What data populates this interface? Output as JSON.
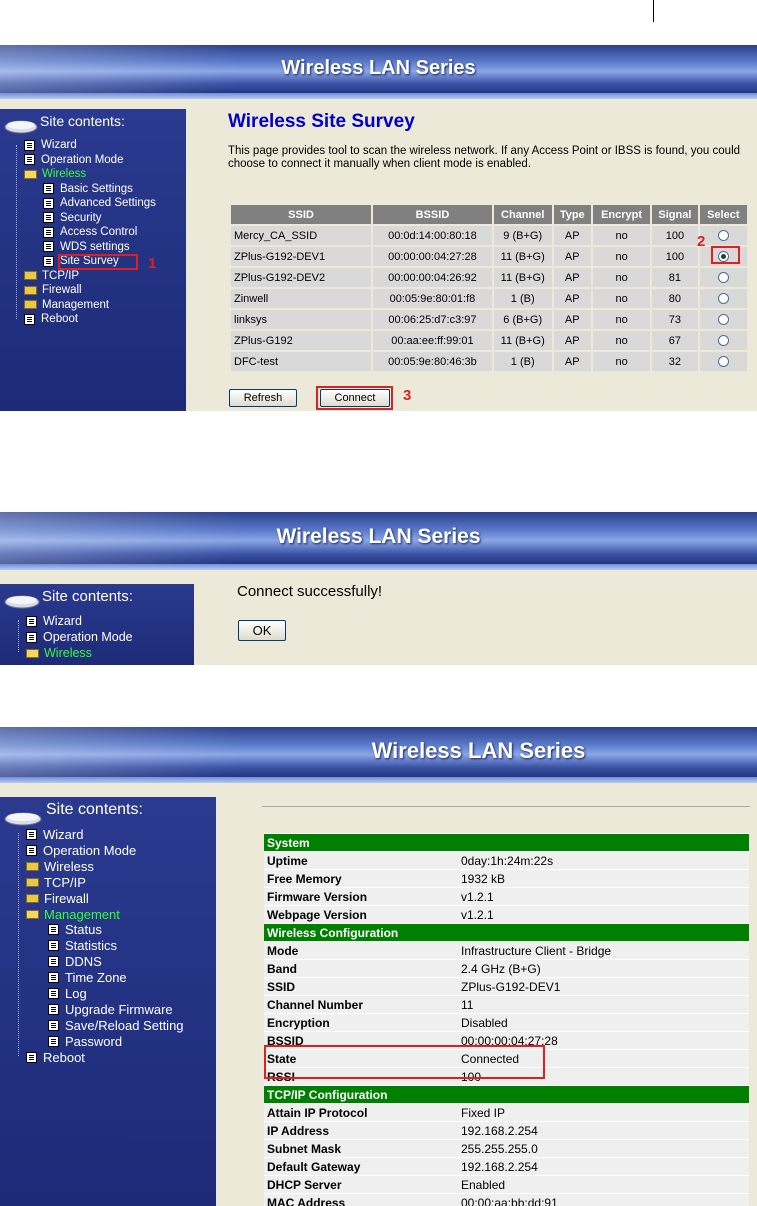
{
  "banner_title": "Wireless LAN Series",
  "sidebar_heading": "Site contents:",
  "survey": {
    "title": "Wireless Site Survey",
    "description": "This page provides tool to scan the wireless network. If any Access Point or IBSS is found, you could choose to connect it manually when client mode is enabled.",
    "columns": [
      "SSID",
      "BSSID",
      "Channel",
      "Type",
      "Encrypt",
      "Signal",
      "Select"
    ],
    "rows": [
      [
        "Mercy_CA_SSID",
        "00:0d:14:00:80:18",
        "9 (B+G)",
        "AP",
        "no",
        "100"
      ],
      [
        "ZPlus-G192-DEV1",
        "00:00:00:04:27:28",
        "11 (B+G)",
        "AP",
        "no",
        "100"
      ],
      [
        "ZPlus-G192-DEV2",
        "00:00:00:04:26:92",
        "11 (B+G)",
        "AP",
        "no",
        "81"
      ],
      [
        "Zinwell",
        "00:05:9e:80:01:f8",
        "1 (B)",
        "AP",
        "no",
        "80"
      ],
      [
        "linksys",
        "00:06:25:d7:c3:97",
        "6 (B+G)",
        "AP",
        "no",
        "73"
      ],
      [
        "ZPlus-G192",
        "00:aa:ee:ff:99:01",
        "11 (B+G)",
        "AP",
        "no",
        "67"
      ],
      [
        "DFC-test",
        "00:05:9e:80:46:3b",
        "1 (B)",
        "AP",
        "no",
        "32"
      ]
    ],
    "selected_row": 1,
    "refresh_label": "Refresh",
    "connect_label": "Connect",
    "step_markers": [
      "1",
      "2",
      "3"
    ],
    "nav": [
      {
        "label": "Wizard",
        "type": "doc",
        "level": 0
      },
      {
        "label": "Operation Mode",
        "type": "doc",
        "level": 0
      },
      {
        "label": "Wireless",
        "type": "folder-open",
        "level": 0,
        "active": true
      },
      {
        "label": "Basic Settings",
        "type": "doc",
        "level": 1
      },
      {
        "label": "Advanced Settings",
        "type": "doc",
        "level": 1
      },
      {
        "label": "Security",
        "type": "doc",
        "level": 1
      },
      {
        "label": "Access Control",
        "type": "doc",
        "level": 1
      },
      {
        "label": "WDS settings",
        "type": "doc",
        "level": 1
      },
      {
        "label": "Site Survey",
        "type": "doc",
        "level": 1
      },
      {
        "label": "TCP/IP",
        "type": "folder",
        "level": 0
      },
      {
        "label": "Firewall",
        "type": "folder",
        "level": 0
      },
      {
        "label": "Management",
        "type": "folder",
        "level": 0
      },
      {
        "label": "Reboot",
        "type": "doc",
        "level": 0
      }
    ]
  },
  "connect_result": {
    "message": "Connect successfully!",
    "ok_label": "OK",
    "nav": [
      {
        "label": "Wizard",
        "type": "doc",
        "level": 0
      },
      {
        "label": "Operation Mode",
        "type": "doc",
        "level": 0
      },
      {
        "label": "Wireless",
        "type": "folder-open",
        "level": 0,
        "active": true
      }
    ]
  },
  "status": {
    "nav": [
      {
        "label": "Wizard",
        "type": "doc",
        "level": 0
      },
      {
        "label": "Operation Mode",
        "type": "doc",
        "level": 0
      },
      {
        "label": "Wireless",
        "type": "folder",
        "level": 0
      },
      {
        "label": "TCP/IP",
        "type": "folder",
        "level": 0
      },
      {
        "label": "Firewall",
        "type": "folder",
        "level": 0
      },
      {
        "label": "Management",
        "type": "folder-open",
        "level": 0,
        "active": true
      },
      {
        "label": "Status",
        "type": "doc",
        "level": 1
      },
      {
        "label": "Statistics",
        "type": "doc",
        "level": 1
      },
      {
        "label": "DDNS",
        "type": "doc",
        "level": 1
      },
      {
        "label": "Time Zone",
        "type": "doc",
        "level": 1
      },
      {
        "label": "Log",
        "type": "doc",
        "level": 1
      },
      {
        "label": "Upgrade Firmware",
        "type": "doc",
        "level": 1
      },
      {
        "label": "Save/Reload Setting",
        "type": "doc",
        "level": 1
      },
      {
        "label": "Password",
        "type": "doc",
        "level": 1
      },
      {
        "label": "Reboot",
        "type": "doc",
        "level": 0
      }
    ],
    "rows": [
      {
        "section": "System"
      },
      {
        "key": "Uptime",
        "value": "0day:1h:24m:22s"
      },
      {
        "key": "Free Memory",
        "value": "1932 kB"
      },
      {
        "key": "Firmware Version",
        "value": "v1.2.1"
      },
      {
        "key": "Webpage Version",
        "value": "v1.2.1"
      },
      {
        "section": "Wireless Configuration"
      },
      {
        "key": "Mode",
        "value": "Infrastructure Client - Bridge"
      },
      {
        "key": "Band",
        "value": "2.4 GHz (B+G)"
      },
      {
        "key": "SSID",
        "value": "ZPlus-G192-DEV1"
      },
      {
        "key": "Channel Number",
        "value": "11"
      },
      {
        "key": "Encryption",
        "value": "Disabled"
      },
      {
        "key": "BSSID",
        "value": "00:00:00:04:27:28"
      },
      {
        "key": "State",
        "value": "Connected"
      },
      {
        "key": "RSSI",
        "value": "100"
      },
      {
        "section": "TCP/IP Configuration"
      },
      {
        "key": "Attain IP Protocol",
        "value": "Fixed IP"
      },
      {
        "key": "IP Address",
        "value": "192.168.2.254"
      },
      {
        "key": "Subnet Mask",
        "value": "255.255.255.0"
      },
      {
        "key": "Default Gateway",
        "value": "192.168.2.254"
      },
      {
        "key": "DHCP Server",
        "value": "Enabled"
      },
      {
        "key": "MAC Address",
        "value": "00:00:aa:bb:dd:91"
      }
    ]
  }
}
